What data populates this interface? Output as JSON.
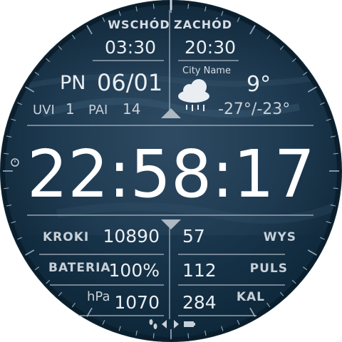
{
  "sun": {
    "sunrise_label": "WSCHÓD",
    "sunset_label": "ZACHÓD",
    "sunrise_time": "03:30",
    "sunset_time": "20:30"
  },
  "date": {
    "day": "PN",
    "date": "06/01"
  },
  "indices": {
    "uvi_label": "UVI",
    "uvi_value": "1",
    "pai_label": "PAI",
    "pai_value": "14"
  },
  "weather": {
    "city": "City Name",
    "icon": "cloud-rain-icon",
    "temperature": "9°",
    "range": "-27°/-23°"
  },
  "time": {
    "display": "22:58:17"
  },
  "stats": {
    "steps_label": "KROKI",
    "steps_value": "10890",
    "battery_label": "BATERIA",
    "battery_value": "100%",
    "pressure_label": "hPa",
    "pressure_value": "1070",
    "altitude_label": "WYS",
    "altitude_value": "57",
    "pulse_label": "PULS",
    "pulse_value": "112",
    "calories_label": "KAL",
    "calories_value": "284"
  },
  "colors": {
    "face_top": "#27405a",
    "face_bottom": "#143247",
    "text": "#e9eef2",
    "label": "#c7d0d8",
    "divider": "#aeb8c2"
  }
}
